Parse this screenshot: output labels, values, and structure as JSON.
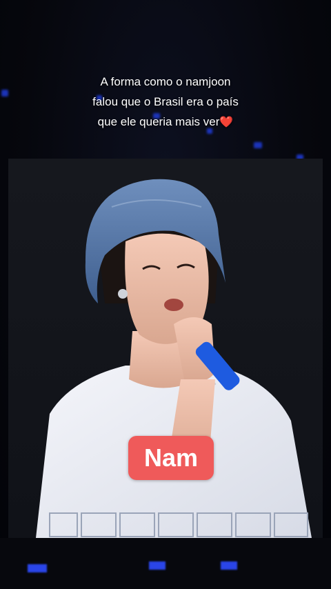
{
  "caption": {
    "line1": "A forma como o namjoon",
    "line2": "falou que o Brasil era o país",
    "line3": "que ele queria mais ver",
    "emoji": "❤️"
  },
  "sticker": {
    "text": "Nam",
    "color": "#ef5a5a"
  },
  "colors": {
    "background": "#05060c",
    "stage_lights": "#2a45e8",
    "hat": "#5a7fb0",
    "shirt": "#eef0f6",
    "microphone": "#1e5be0"
  }
}
